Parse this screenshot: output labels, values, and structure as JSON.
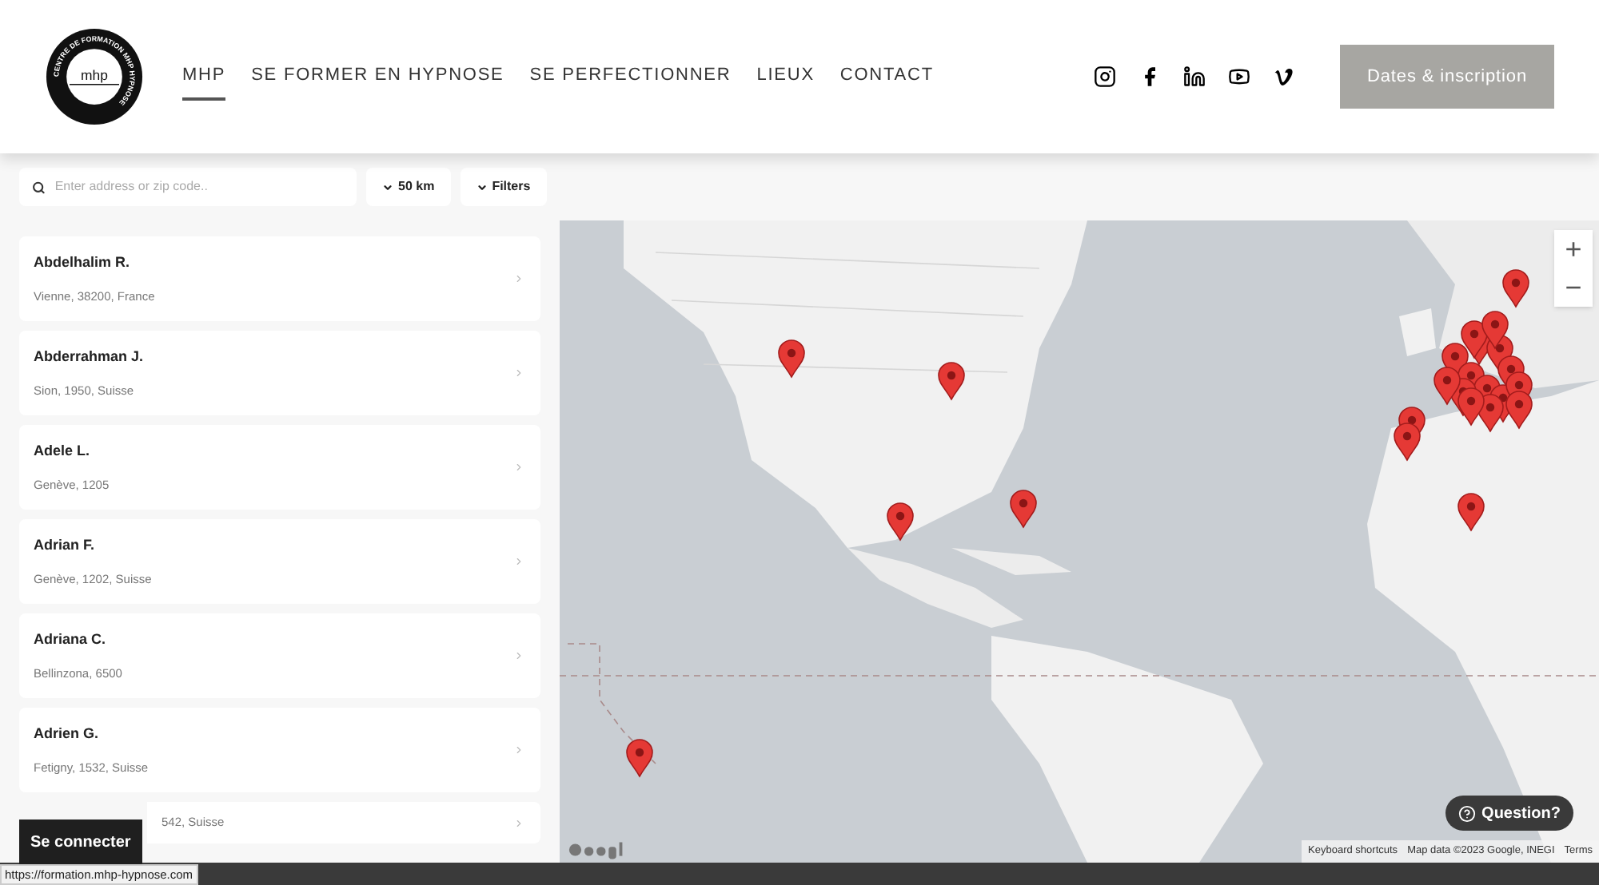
{
  "logo": {
    "ring_text": "CENTRE DE FORMATION MHP HYPNOSE",
    "wordmark": "mhp"
  },
  "nav": [
    {
      "label": "MHP",
      "selected": true
    },
    {
      "label": "SE FORMER EN HYPNOSE",
      "selected": false
    },
    {
      "label": "SE PERFECTIONNER",
      "selected": false
    },
    {
      "label": "LIEUX",
      "selected": false
    },
    {
      "label": "CONTACT",
      "selected": false
    }
  ],
  "social": [
    {
      "kind": "instagram"
    },
    {
      "kind": "facebook"
    },
    {
      "kind": "linkedin"
    },
    {
      "kind": "youtube"
    },
    {
      "kind": "vimeo"
    }
  ],
  "cta": "Dates & inscription",
  "search": {
    "placeholder": "Enter address or zip code.."
  },
  "radius": "50 km",
  "filters": "Filters",
  "practitioners": [
    {
      "name": "Abdelhalim R.",
      "location": "Vienne, 38200, France"
    },
    {
      "name": "Abderrahman J.",
      "location": "Sion, 1950, Suisse"
    },
    {
      "name": "Adele L.",
      "location": "Genève, 1205"
    },
    {
      "name": "Adrian F.",
      "location": "Genève, 1202, Suisse"
    },
    {
      "name": "Adriana C.",
      "location": "Bellinzona, 6500"
    },
    {
      "name": "Adrien G.",
      "location": "Fetigny, 1532, Suisse"
    },
    {
      "location": "542, Suisse"
    }
  ],
  "map": {
    "kind": "picture",
    "zoom_in": "+",
    "zoom_out": "−",
    "attribution": [
      "Keyboard shortcuts",
      "Map data ©2023 Google, INEGI",
      "Terms"
    ]
  },
  "login": "Se connecter",
  "question": "Question?",
  "status_url": "https://formation.mhp-hypnose.com"
}
